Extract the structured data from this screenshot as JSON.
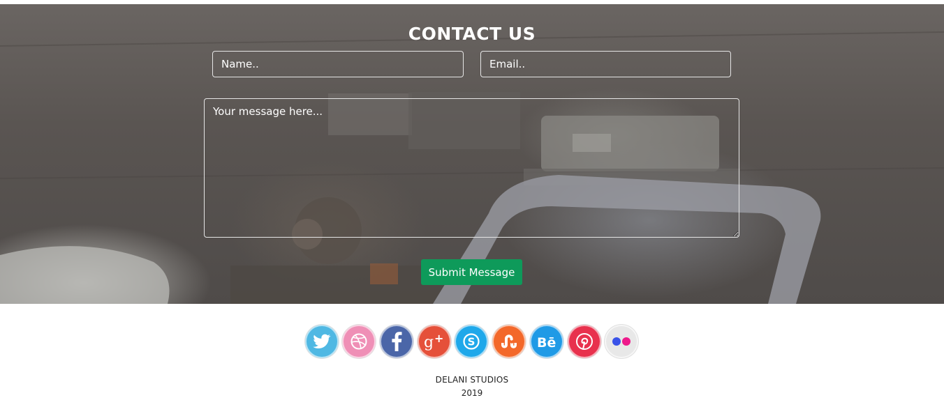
{
  "contact": {
    "title": "CONTACT US",
    "name_placeholder": "Name..",
    "email_placeholder": "Email..",
    "message_placeholder": "Your message here...",
    "submit_label": "Submit Message"
  },
  "social": [
    {
      "icon": "twitter-icon",
      "color": "#4fb8e3"
    },
    {
      "icon": "dribbble-icon",
      "color": "#ef8fb6"
    },
    {
      "icon": "facebook-icon",
      "color": "#4b66a8"
    },
    {
      "icon": "google-plus-icon",
      "color": "#e5503a"
    },
    {
      "icon": "skype-icon",
      "color": "#1fa8ea"
    },
    {
      "icon": "stumbleupon-icon",
      "color": "#f3682a"
    },
    {
      "icon": "behance-icon",
      "color": "#1f9ae6"
    },
    {
      "icon": "pinterest-icon",
      "color": "#e8314d"
    },
    {
      "icon": "flickr-icon",
      "color": "#e8e8e8"
    }
  ],
  "footer": {
    "brand": "DELANI STUDIOS",
    "year": "2019"
  },
  "colors": {
    "submit_button": "#0e9a5a",
    "overlay": "#5a5552"
  }
}
